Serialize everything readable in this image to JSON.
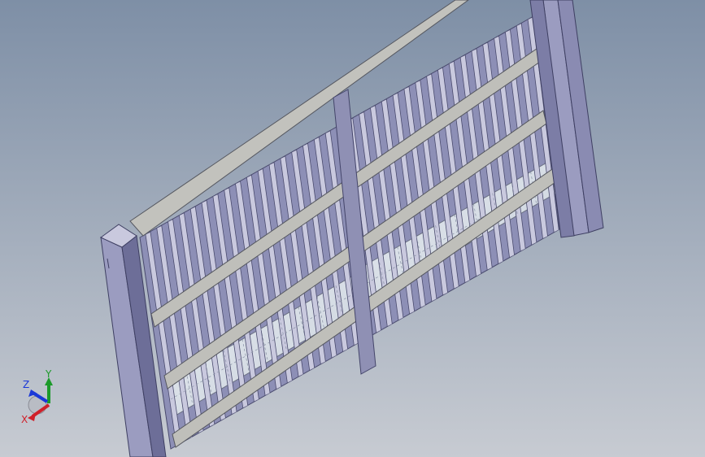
{
  "viewport": {
    "background_top": "#7e8fa6",
    "background_bottom": "#c7cbd2"
  },
  "model": {
    "frame_color": "#9b9cc0",
    "frame_dark": "#6d6e98",
    "frame_light": "#c9c9de",
    "rail_color": "#c2c2bd",
    "panel_color": "#d4dbe4"
  },
  "triad": {
    "x_label": "X",
    "y_label": "Y",
    "z_label": "Z",
    "x_color": "#d0202a",
    "y_color": "#1c9a2a",
    "z_color": "#1a38d8"
  }
}
